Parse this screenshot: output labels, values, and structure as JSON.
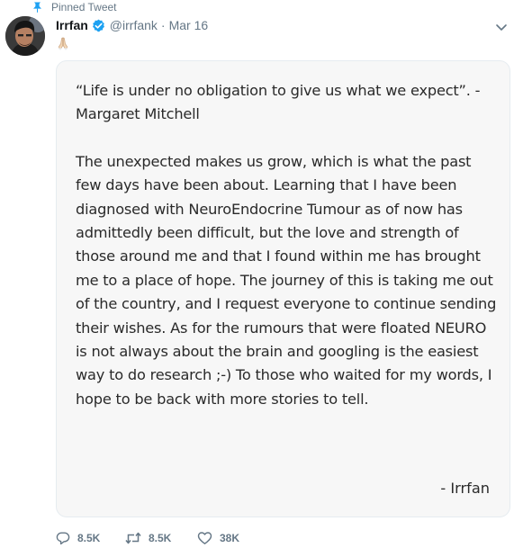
{
  "pinned": {
    "label": "Pinned Tweet"
  },
  "author": {
    "name": "Irrfan",
    "handle": "@irrfank",
    "separator": "·",
    "date": "Mar 16"
  },
  "tweet": {
    "emoji": "🙏🏻",
    "media": {
      "quote": "“Life is under no obligation to give us what we expect”. - Margaret Mitchell",
      "body": "The unexpected makes us grow, which is what the past few days have been about. Learning that I have been diagnosed with NeuroEndocrine Tumour as of now has admittedly been difficult, but the love and strength of those around me and that I found within me has brought me to a place of hope. The journey of this is taking me out of the country, and I request everyone to continue sending their wishes. As for the rumours that were floated NEURO is not always about the brain and googling is the easiest way to do research ;-) To those who waited for my words, I hope to be back with more stories to tell.",
      "signature": "- Irrfan"
    }
  },
  "actions": {
    "replies": "8.5K",
    "retweets": "8.5K",
    "likes": "38K"
  },
  "colors": {
    "accent": "#1da1f2",
    "muted": "#657786",
    "text": "#14171a",
    "card_bg": "#f7f7f7",
    "card_border": "#e6ecf0"
  },
  "icons": {
    "pin": "pin-icon",
    "verified": "verified-badge-icon",
    "menu": "chevron-down-icon",
    "reply": "reply-icon",
    "retweet": "retweet-icon",
    "like": "heart-icon"
  }
}
